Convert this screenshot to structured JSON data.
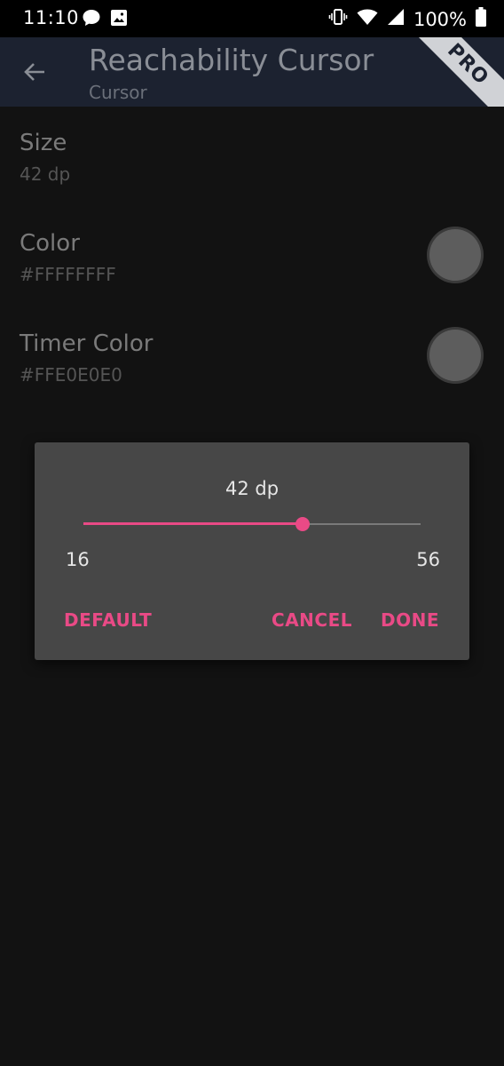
{
  "status_bar": {
    "time": "11:10",
    "battery": "100%"
  },
  "app_bar": {
    "title": "Reachability Cursor",
    "subtitle": "Cursor",
    "badge": "PRO"
  },
  "settings": [
    {
      "title": "Size",
      "value": "42 dp"
    },
    {
      "title": "Color",
      "value": "#FFFFFFFF"
    },
    {
      "title": "Timer Color",
      "value": "#FFE0E0E0"
    }
  ],
  "dialog": {
    "value_label": "42 dp",
    "slider": {
      "min": 16,
      "max": 56,
      "value": 42
    },
    "min_label": "16",
    "max_label": "56",
    "buttons": {
      "default": "DEFAULT",
      "cancel": "CANCEL",
      "done": "DONE"
    }
  },
  "colors": {
    "accent": "#e94a86",
    "app_bar": "#1c2230",
    "background": "#121212",
    "dialog": "#474747"
  },
  "icons": {
    "back": "arrow-left-icon",
    "message": "chat-bubble-icon",
    "image": "image-icon",
    "vibrate": "vibrate-icon",
    "wifi": "wifi-icon",
    "signal": "signal-icon",
    "battery": "battery-icon"
  }
}
